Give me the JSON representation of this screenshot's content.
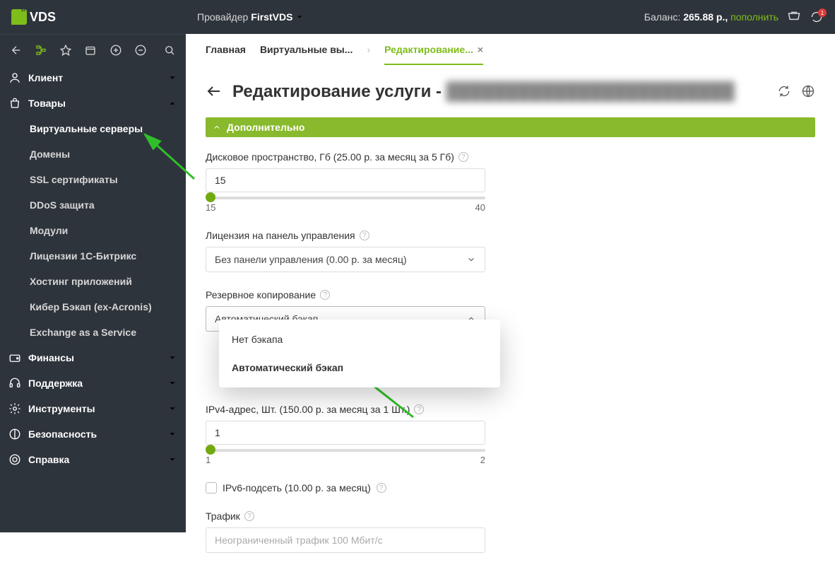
{
  "header": {
    "logo_text": "VDS",
    "provider_prefix": "Провайдер",
    "provider_name": "FirstVDS",
    "balance_prefix": "Баланс:",
    "balance_value": "265.88 р.,",
    "topup": "пополнить",
    "notif_count": "1"
  },
  "tabs": {
    "main": "Главная",
    "vservers": "Виртуальные вы...",
    "editing": "Редактирование..."
  },
  "sidebar": {
    "client": "Клиент",
    "products": "Товары",
    "items": [
      "Виртуальные серверы",
      "Домены",
      "SSL сертификаты",
      "DDoS защита",
      "Модули",
      "Лицензии 1С-Битрикс",
      "Хостинг приложений",
      "Кибер Бэкап (ex-Acronis)",
      "Exchange as a Service"
    ],
    "finance": "Финансы",
    "support": "Поддержка",
    "tools": "Инструменты",
    "security": "Безопасность",
    "help": "Справка"
  },
  "page": {
    "title": "Редактирование услуги -",
    "section": "Дополнительно",
    "disk_label": "Дисковое пространство, Гб (25.00 р. за месяц за 5 Гб)",
    "disk_value": "15",
    "disk_min": "15",
    "disk_max": "40",
    "license_label": "Лицензия на панель управления",
    "license_value": "Без панели управления (0.00 р. за месяц)",
    "backup_label": "Резервное копирование",
    "backup_value": "Автоматический бэкап",
    "backup_options": [
      "Нет бэкапа",
      "Автоматический бэкап"
    ],
    "ipv4_label": "IPv4-адрес, Шт. (150.00 р. за месяц за 1 Шт.)",
    "ipv4_value": "1",
    "ipv4_min": "1",
    "ipv4_max": "2",
    "ipv6_label": "IPv6-подсеть (10.00 р. за месяц)",
    "traffic_label": "Трафик",
    "traffic_value": "Неограниченный трафик 100 Мбит/c"
  }
}
